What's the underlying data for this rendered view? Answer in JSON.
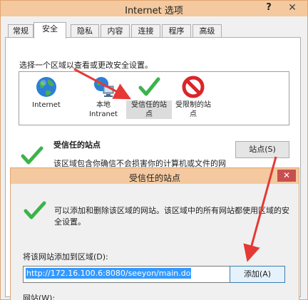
{
  "window": {
    "title": "Internet 选项",
    "help_label": "?",
    "close_label": "✕"
  },
  "tabs": [
    {
      "label": "常规"
    },
    {
      "label": "安全"
    },
    {
      "label": "隐私"
    },
    {
      "label": "内容"
    },
    {
      "label": "连接"
    },
    {
      "label": "程序"
    },
    {
      "label": "高级"
    }
  ],
  "security": {
    "choose_zone_text": "选择一个区域以查看或更改安全设置。",
    "zones": [
      {
        "label": "Internet",
        "icon": "globe-icon"
      },
      {
        "label": "本地\nIntranet",
        "icon": "local-intranet-icon"
      },
      {
        "label": "受信任的站\n点",
        "icon": "green-check-icon"
      },
      {
        "label": "受限制的站\n点",
        "icon": "restricted-icon"
      }
    ],
    "zone_title": "受信任的站点",
    "zone_desc": "该区域包含你确信不会损害你的计算机或文件的网",
    "sites_button": "站点(S)"
  },
  "dialog": {
    "title": "受信任的站点",
    "close_label": "✕",
    "description": "可以添加和删除该区域的网站。该区域中的所有网站都使用区域的安全设置。",
    "add_label": "将该网站添加到区域(D):",
    "url_value": "http://172.16.100.6:8080/seeyon/main.do",
    "add_button": "添加(A)",
    "sites_label": "网站(W):"
  },
  "colors": {
    "title_bar": "#f4c99f",
    "accent_arrow": "#e53935",
    "selection": "#3399ff",
    "check_green": "#3cb34a",
    "restricted_red": "#d9262b"
  }
}
